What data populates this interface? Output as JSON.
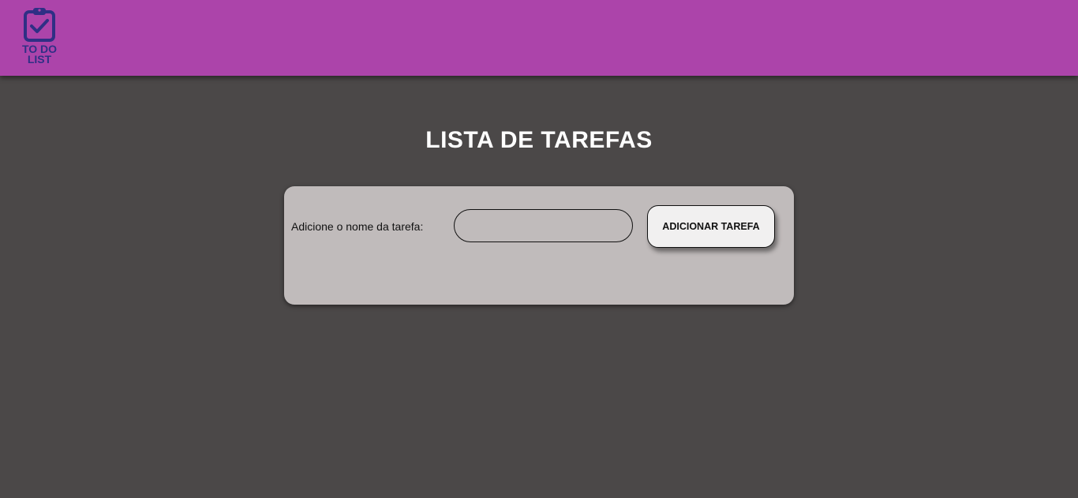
{
  "header": {
    "logo": {
      "icon": "clipboard-check-icon",
      "text_line1": "TO DO",
      "text_line2": "LIST",
      "color": "#2f2f85"
    },
    "background_color": "#ac44aa"
  },
  "main": {
    "title": "LISTA DE TAREFAS",
    "background_color": "#4b4848"
  },
  "form": {
    "label": "Adicione o nome da tarefa:",
    "input_value": "",
    "button_label": "ADICIONAR TAREFA",
    "panel_color": "#c0bbbb"
  }
}
